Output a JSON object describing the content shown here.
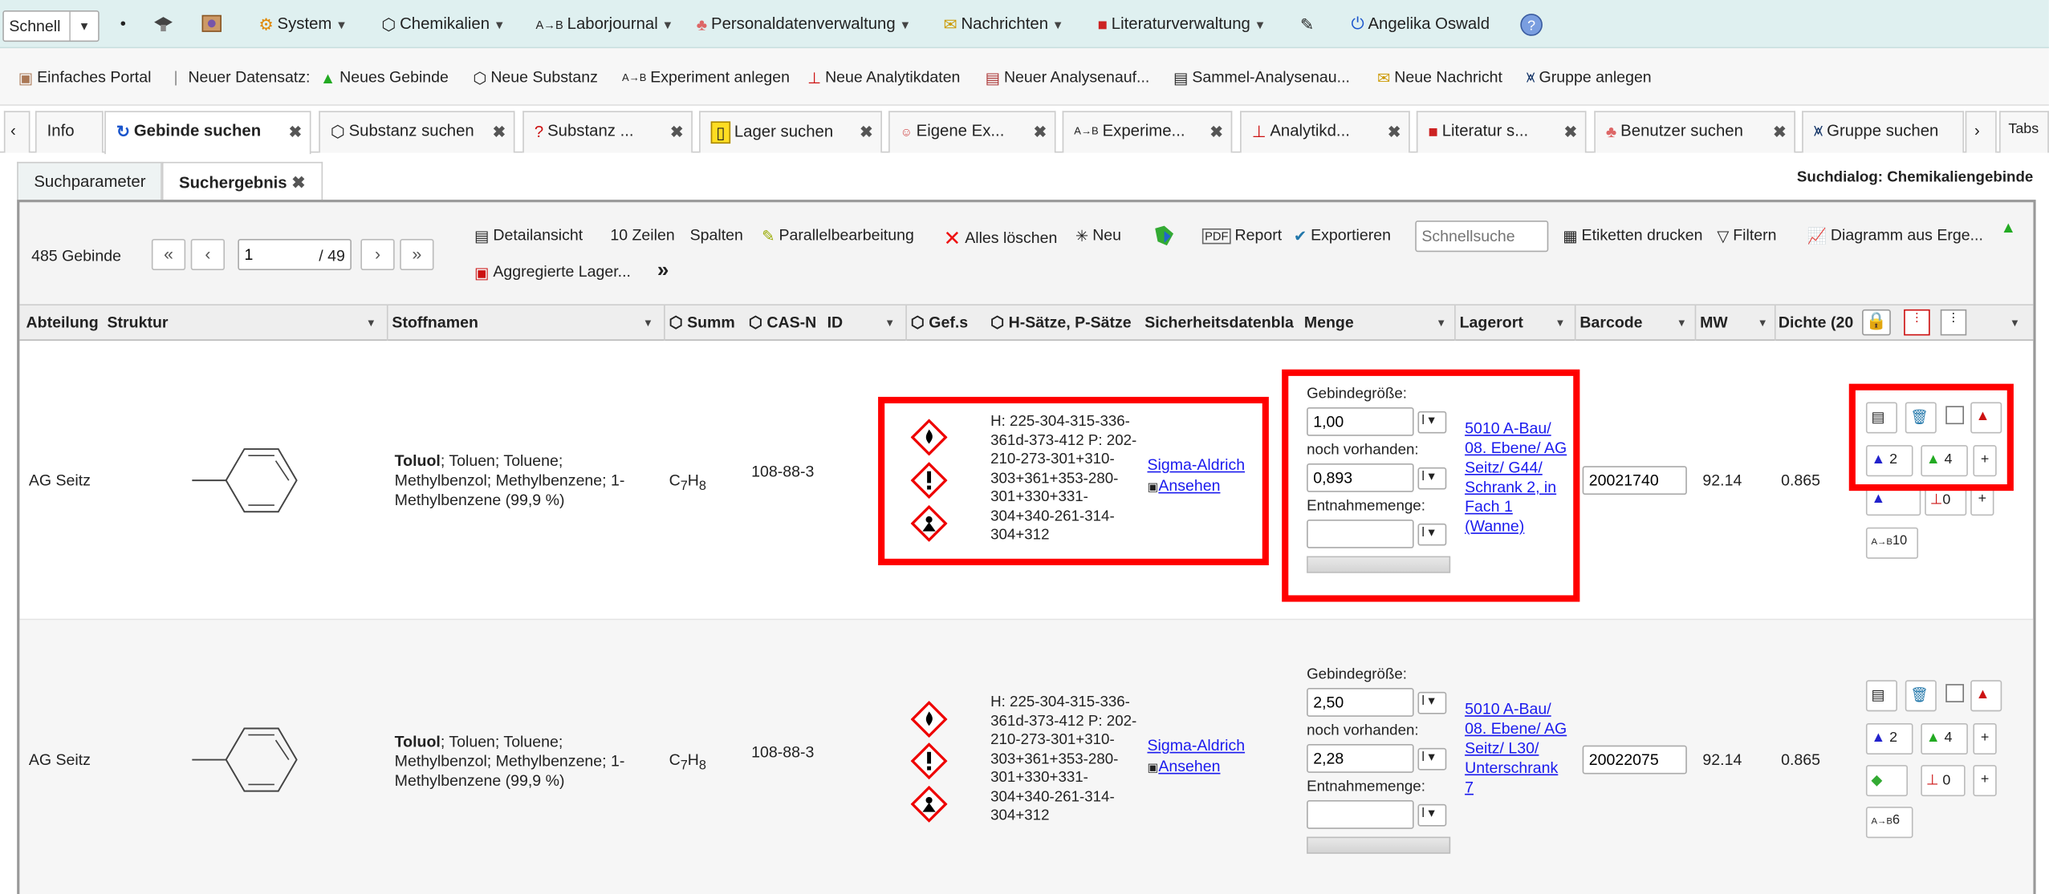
{
  "topbar": {
    "quick": "Schnell",
    "menus": [
      "System",
      "Chemikalien",
      "Laborjournal",
      "Personaldatenverwaltung",
      "Nachrichten",
      "Literaturverwaltung"
    ],
    "user": "Angelika Oswald"
  },
  "toolbar2": {
    "portal": "Einfaches Portal",
    "new_record": "Neuer Datensatz:",
    "items": [
      "Neues Gebinde",
      "Neue Substanz",
      "Experiment anlegen",
      "Neue Analytikdaten",
      "Neuer Analysenauf...",
      "Sammel-Analysenau...",
      "Neue Nachricht",
      "Gruppe anlegen"
    ]
  },
  "tabs": {
    "items": [
      "Info",
      "Gebinde suchen",
      "Substanz suchen",
      "Substanz ...",
      "Lager suchen",
      "Eigene Ex...",
      "Experime...",
      "Analytikd...",
      "Literatur s...",
      "Benutzer suchen",
      "Gruppe suchen"
    ],
    "more": "Tabs"
  },
  "subtabs": {
    "items": [
      "Suchparameter",
      "Suchergebnis"
    ],
    "dialog": "Suchdialog: Chemikaliengebinde"
  },
  "results": {
    "count": "485 Gebinde",
    "page": "1",
    "pages": "/ 49",
    "actions": [
      "Detailansicht",
      "10 Zeilen",
      "Spalten",
      "Parallelbearbeitung",
      "Alles löschen",
      "Neu",
      "Report",
      "Exportieren",
      "Etiketten drucken",
      "Filtern",
      "Diagramm aus Erge..."
    ],
    "search_placeholder": "Schnellsuche",
    "agg": "Aggregierte Lager..."
  },
  "columns": [
    "Abteilung",
    "Struktur",
    "Stoffnamen",
    "Summ",
    "CAS-N",
    "ID",
    "Gef.s",
    "H-Sätze, P-Sätze",
    "Sicherheitsdatenbla",
    "Menge",
    "Lagerort",
    "Barcode",
    "MW",
    "Dichte (20"
  ],
  "rows": [
    {
      "dept": "AG Seitz",
      "name_bold": "Toluol",
      "name_rest": "; Toluen; Toluene; Methylbenzol; Methylbenzene; 1-Methylbenzene (99,9 %)",
      "formula": "C",
      "formula_h": "H",
      "f7": "7",
      "f8": "8",
      "cas": "108-88-3",
      "hp": "H: 225-304-315-336-361d-373-412 P: 202-210-273-301+310-303+361+353-280-301+330+331-304+340-261-314-304+312",
      "sds_vendor": "Sigma-Aldrich",
      "sds_view": "Ansehen",
      "size_label": "Gebindegröße:",
      "size": "1,00",
      "unit": "l",
      "avail_label": "noch vorhanden:",
      "avail": "0,893",
      "take_label": "Entnahmemenge:",
      "location": "5010 A-Bau/ 08. Ebene/ AG Seitz/ G44/ Schrank 2, in Fach 1 (Wanne)",
      "barcode": "20021740",
      "mw": "92.14",
      "density": "0.865",
      "c_2": "2",
      "c_4": "4",
      "c_0": "0",
      "c_exp": "10"
    },
    {
      "dept": "AG Seitz",
      "name_bold": "Toluol",
      "name_rest": "; Toluen; Toluene; Methylbenzol; Methylbenzene; 1-Methylbenzene (99,9 %)",
      "formula": "C",
      "formula_h": "H",
      "f7": "7",
      "f8": "8",
      "cas": "108-88-3",
      "hp": "H: 225-304-315-336-361d-373-412 P: 202-210-273-301+310-303+361+353-280-301+330+331-304+340-261-314-304+312",
      "sds_vendor": "Sigma-Aldrich",
      "sds_view": "Ansehen",
      "size_label": "Gebindegröße:",
      "size": "2,50",
      "unit": "l",
      "avail_label": "noch vorhanden:",
      "avail": "2,28",
      "take_label": "Entnahmemenge:",
      "location": "5010 A-Bau/ 08. Ebene/ AG Seitz/ L30/ Unterschrank 7",
      "barcode": "20022075",
      "mw": "92.14",
      "density": "0.865",
      "c_2": "2",
      "c_4": "4",
      "c_0": "0",
      "c_exp": "6"
    }
  ],
  "colors": {
    "highlight": "#ff0000",
    "topbar": "#dff0f0",
    "link": "#1a1aee"
  }
}
